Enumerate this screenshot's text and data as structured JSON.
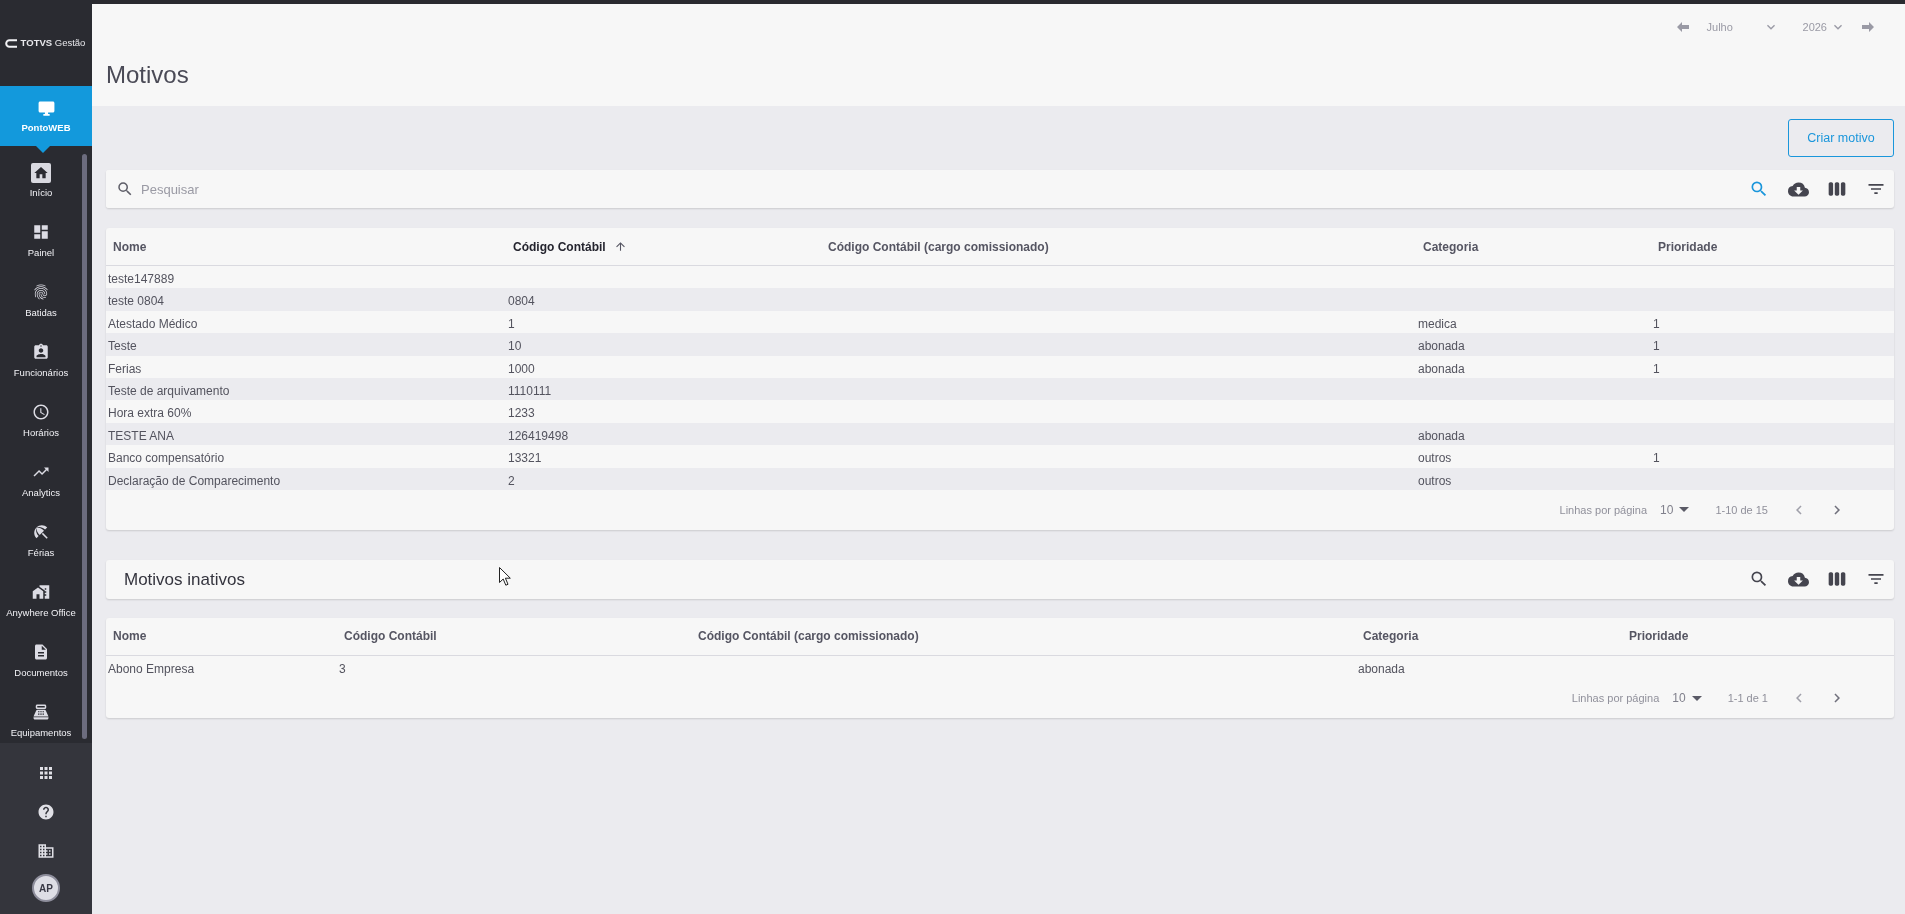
{
  "sidebar": {
    "logo_text": "**TOTVS** Gestão",
    "module": {
      "label": "PontoWEB"
    },
    "nav_items": [
      {
        "label": "Início"
      },
      {
        "label": "Painel"
      },
      {
        "label": "Batidas"
      },
      {
        "label": "Funcionários"
      },
      {
        "label": "Horários"
      },
      {
        "label": "Analytics"
      },
      {
        "label": "Férias"
      },
      {
        "label": "Anywhere Office"
      },
      {
        "label": "Documentos"
      },
      {
        "label": "Equipamentos"
      }
    ],
    "avatar": {
      "initials": "AP"
    }
  },
  "header": {
    "period": {
      "month": "Julho",
      "year": "2026"
    },
    "title": "Motivos"
  },
  "create_button": {
    "label": "Criar motivo"
  },
  "search": {
    "placeholder": "Pesquisar",
    "search_active": true
  },
  "table": {
    "columns": [
      {
        "label": "Nome",
        "sorted": false
      },
      {
        "label": "Código Contábil",
        "sorted": true
      },
      {
        "label": "Código Contábil (cargo comissionado)",
        "sorted": false
      },
      {
        "label": "Categoria",
        "sorted": false
      },
      {
        "label": "Prioridade",
        "sorted": false
      }
    ],
    "rows": [
      {
        "nome": "teste147889"
      },
      {
        "nome": "teste 0804",
        "codigo_contabil": "0804"
      },
      {
        "nome": "Atestado Médico",
        "codigo_contabil": "1",
        "categoria": "medica",
        "prioridade": "1"
      },
      {
        "nome": "Teste",
        "codigo_contabil": "10",
        "categoria": "abonada",
        "prioridade": "1"
      },
      {
        "nome": "Ferias",
        "codigo_contabil": "1000",
        "categoria": "abonada",
        "prioridade": "1"
      },
      {
        "nome": "Teste de arquivamento",
        "codigo_contabil": "1110111"
      },
      {
        "nome": "Hora extra 60%",
        "codigo_contabil": "1233"
      },
      {
        "nome": "TESTE ANA",
        "codigo_contabil": "126419498",
        "categoria": "abonada"
      },
      {
        "nome": "Banco compensatório",
        "codigo_contabil": "13321",
        "categoria": "outros",
        "prioridade": "1"
      },
      {
        "nome": "Declaração de Comparecimento",
        "codigo_contabil": "2",
        "categoria": "outros"
      }
    ],
    "pagination": {
      "rows_per_page_label": "Linhas por página",
      "rows_per_page": "10",
      "range": "1-10 de 15"
    }
  },
  "inactive": {
    "title": "Motivos inativos",
    "search_active": false,
    "table": {
      "columns": [
        {
          "label": "Nome"
        },
        {
          "label": "Código Contábil"
        },
        {
          "label": "Código Contábil (cargo comissionado)"
        },
        {
          "label": "Categoria"
        },
        {
          "label": "Prioridade"
        }
      ],
      "rows": [
        {
          "nome": "Abono Empresa",
          "codigo_contabil": "3",
          "categoria": "abonada"
        }
      ],
      "pagination": {
        "rows_per_page_label": "Linhas por página",
        "rows_per_page": "10",
        "range": "1-1 de 1"
      }
    }
  }
}
